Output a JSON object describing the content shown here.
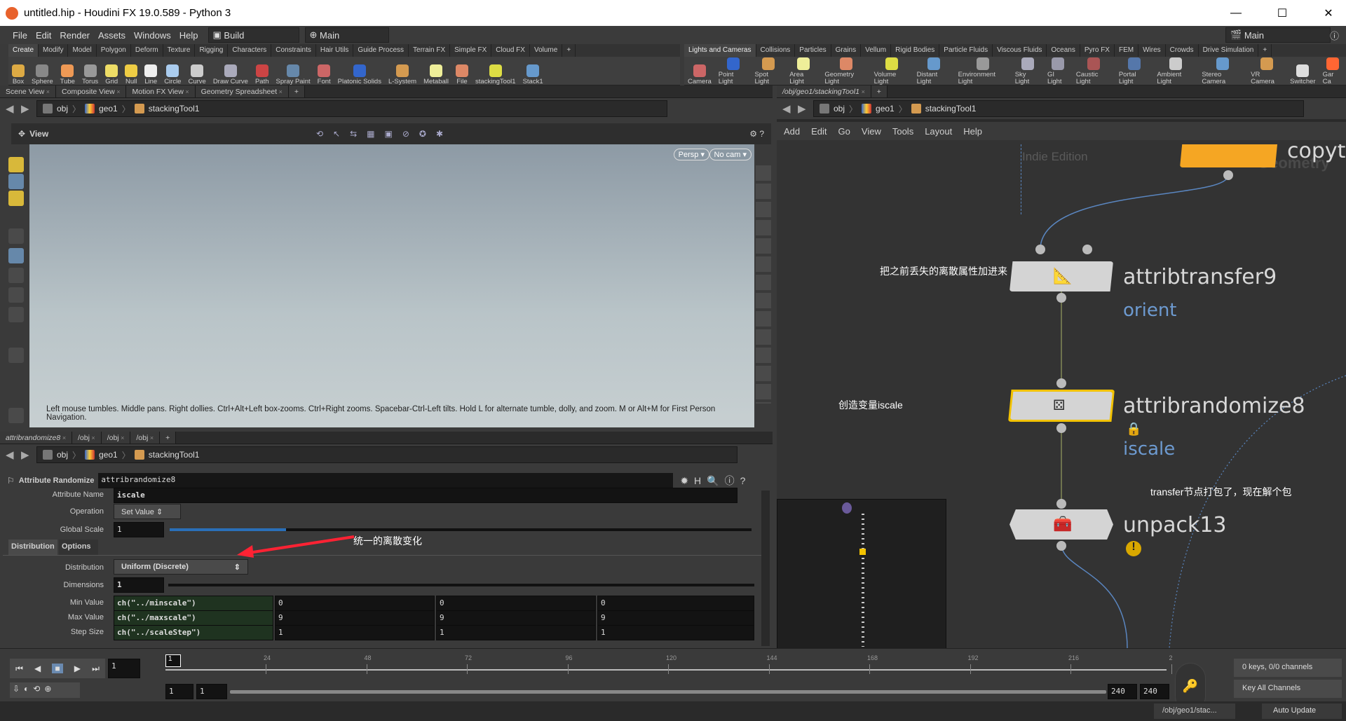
{
  "window": {
    "title": "untitled.hip - Houdini FX 19.0.589 - Python 3"
  },
  "menu": {
    "items": [
      "File",
      "Edit",
      "Render",
      "Assets",
      "Windows",
      "Help"
    ],
    "desktop": "Build",
    "main_left": "Main",
    "main_right": "Main"
  },
  "shelf_left": {
    "tabs": [
      "Create",
      "Modify",
      "Model",
      "Polygon",
      "Deform",
      "Texture",
      "Rigging",
      "Characters",
      "Constraints",
      "Hair Utils",
      "Guide Process",
      "Terrain FX",
      "Simple FX",
      "Cloud FX",
      "Volume"
    ],
    "tools": [
      "Box",
      "Sphere",
      "Tube",
      "Torus",
      "Grid",
      "Null",
      "Line",
      "Circle",
      "Curve",
      "Draw Curve",
      "Path",
      "Spray Paint",
      "Font",
      "Platonic Solids",
      "L-System",
      "Metaball",
      "File",
      "stackingTool1",
      "Stack1"
    ]
  },
  "shelf_right": {
    "tabs": [
      "Lights and Cameras",
      "Collisions",
      "Particles",
      "Grains",
      "Vellum",
      "Rigid Bodies",
      "Particle Fluids",
      "Viscous Fluids",
      "Oceans",
      "Pyro FX",
      "FEM",
      "Wires",
      "Crowds",
      "Drive Simulation"
    ],
    "tools": [
      "Camera",
      "Point Light",
      "Spot Light",
      "Area Light",
      "Geometry Light",
      "Volume Light",
      "Distant Light",
      "Environment Light",
      "Sky Light",
      "GI Light",
      "Caustic Light",
      "Portal Light",
      "Ambient Light",
      "Stereo Camera",
      "VR Camera",
      "Switcher",
      "Gar Ca"
    ]
  },
  "scene": {
    "tabs": [
      "Scene View",
      "Composite View",
      "Motion FX View",
      "Geometry Spreadsheet"
    ],
    "path": [
      "obj",
      "geo1",
      "stackingTool1"
    ],
    "view_label": "View",
    "persp": "Persp",
    "cam": "No cam",
    "hint": "Left mouse tumbles. Middle pans. Right dollies. Ctrl+Alt+Left box-zooms. Ctrl+Right zooms. Spacebar-Ctrl-Left tilts. Hold L for alternate tumble, dolly, and zoom.     M or Alt+M for First Person Navigation."
  },
  "params": {
    "tabs": [
      "attribrandomize8",
      "/obj",
      "/obj",
      "/obj"
    ],
    "path": [
      "obj",
      "geo1",
      "stackingTool1"
    ],
    "node_type": "Attribute Randomize",
    "node_name": "attribrandomize8",
    "attribute_name_label": "Attribute Name",
    "attribute_name": "iscale",
    "operation_label": "Operation",
    "operation": "Set Value",
    "global_scale_label": "Global Scale",
    "global_scale": "1",
    "global_scale_fraction": 0.2,
    "subtabs": [
      "Distribution",
      "Options"
    ],
    "annotation": "统一的离散变化",
    "distribution_label": "Distribution",
    "distribution": "Uniform (Discrete)",
    "dimensions_label": "Dimensions",
    "dimensions": "1",
    "min_label": "Min Value",
    "min": [
      "ch(\"../minscale\")",
      "0",
      "0",
      "0"
    ],
    "max_label": "Max Value",
    "max": [
      "ch(\"../maxscale\")",
      "9",
      "9",
      "9"
    ],
    "step_label": "Step Size",
    "step": [
      "ch(\"../scaleStep\")",
      "1",
      "1",
      "1"
    ]
  },
  "network": {
    "tab": "/obj/geo1/stackingTool1",
    "path": [
      "obj",
      "geo1",
      "stackingTool1"
    ],
    "menu": [
      "Add",
      "Edit",
      "Go",
      "View",
      "Tools",
      "Layout",
      "Help"
    ],
    "watermark": "Indie Edition",
    "context_watermark": "Geometry",
    "nodes": [
      {
        "name": "copyto",
        "flag": ""
      },
      {
        "name": "attribtransfer9",
        "flag": "orient"
      },
      {
        "name": "attribrandomize8",
        "flag": "iscale"
      },
      {
        "name": "unpack13",
        "flag": ""
      }
    ],
    "comments": [
      "把之前丢失的离散属性加进来",
      "创造变量iscale",
      "transfer节点打包了，现在解个包"
    ]
  },
  "timeline": {
    "frame": "1",
    "ticks": [
      "24",
      "48",
      "72",
      "96",
      "120",
      "144",
      "168",
      "192",
      "216",
      "2"
    ],
    "start": "1",
    "start2": "1",
    "end": "240",
    "end2": "240",
    "keys": "0 keys, 0/0 channels",
    "key_channels": "Key All Channels"
  },
  "status": {
    "path": "/obj/geo1/stac...",
    "update": "Auto Update"
  },
  "colors": {
    "accent": "#f5a623",
    "flag": "#6d9ad0",
    "selected": "#f2c200"
  }
}
